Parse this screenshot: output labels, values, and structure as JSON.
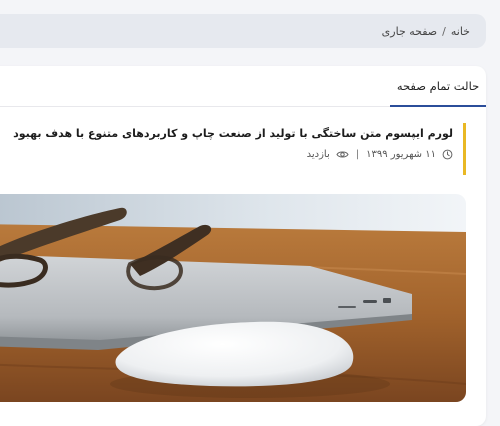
{
  "breadcrumb": {
    "home": "خانه",
    "separator": "/",
    "current": "صفحه جاری"
  },
  "tabs": {
    "active_label": "حالت تمام صفحه"
  },
  "post": {
    "title": "لورم ایپسوم متن ساختگی با تولید از صنعت چاپ و کاربردهای متنوع با هدف بهبود",
    "date": "۱۱ شهریور ۱۳۹۹",
    "meta_separator": "|",
    "views_label": "بازدید"
  },
  "colors": {
    "page_background": "#f4f5f8",
    "breadcrumb_background": "#e6e9ef",
    "tab_underline": "#2b4d9a",
    "accent_bar": "#e9b824"
  },
  "icons": {
    "date": "clock-icon",
    "views": "eye-icon"
  },
  "image": {
    "subject": "laptop, eyeglasses and mouse on wooden desk"
  }
}
